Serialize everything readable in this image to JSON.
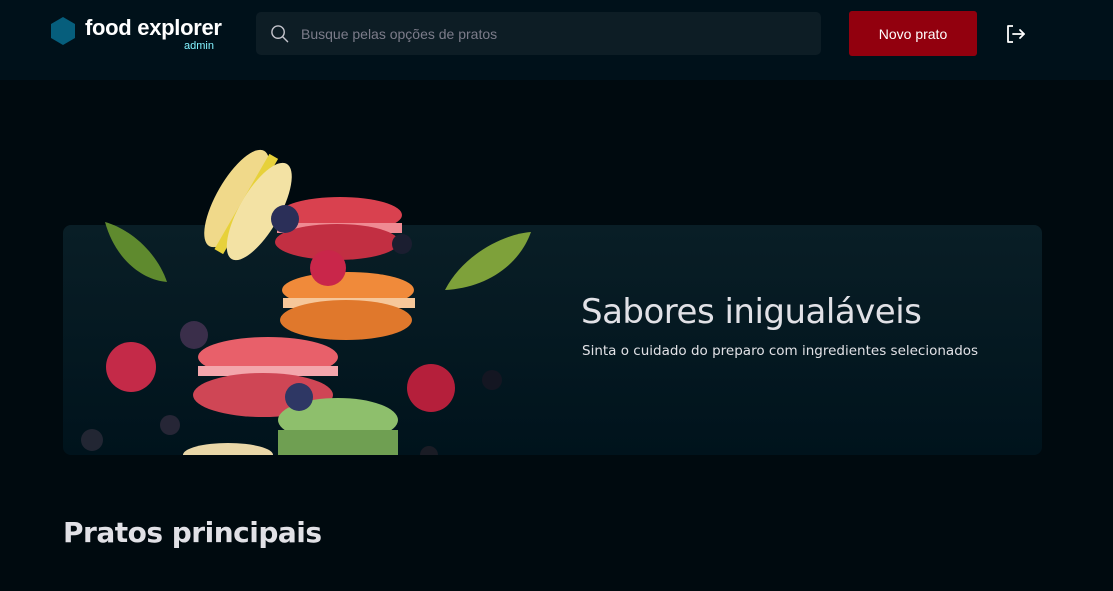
{
  "header": {
    "brand_name": "food explorer",
    "brand_role": "admin",
    "search": {
      "placeholder": "Busque pelas opções de pratos"
    },
    "new_dish_label": "Novo prato"
  },
  "banner": {
    "title": "Sabores inigualáveis",
    "subtitle": "Sinta o cuidado do preparo com ingredientes selecionados"
  },
  "section": {
    "title": "Pratos principais"
  },
  "colors": {
    "header_bg": "#00111a",
    "page_bg": "#000a0f",
    "accent_button": "#92000e",
    "brand_role": "#82f3ff",
    "logo": "#065e7c"
  },
  "icons": [
    "hexagon-logo-icon",
    "search-icon",
    "sign-out-icon"
  ]
}
